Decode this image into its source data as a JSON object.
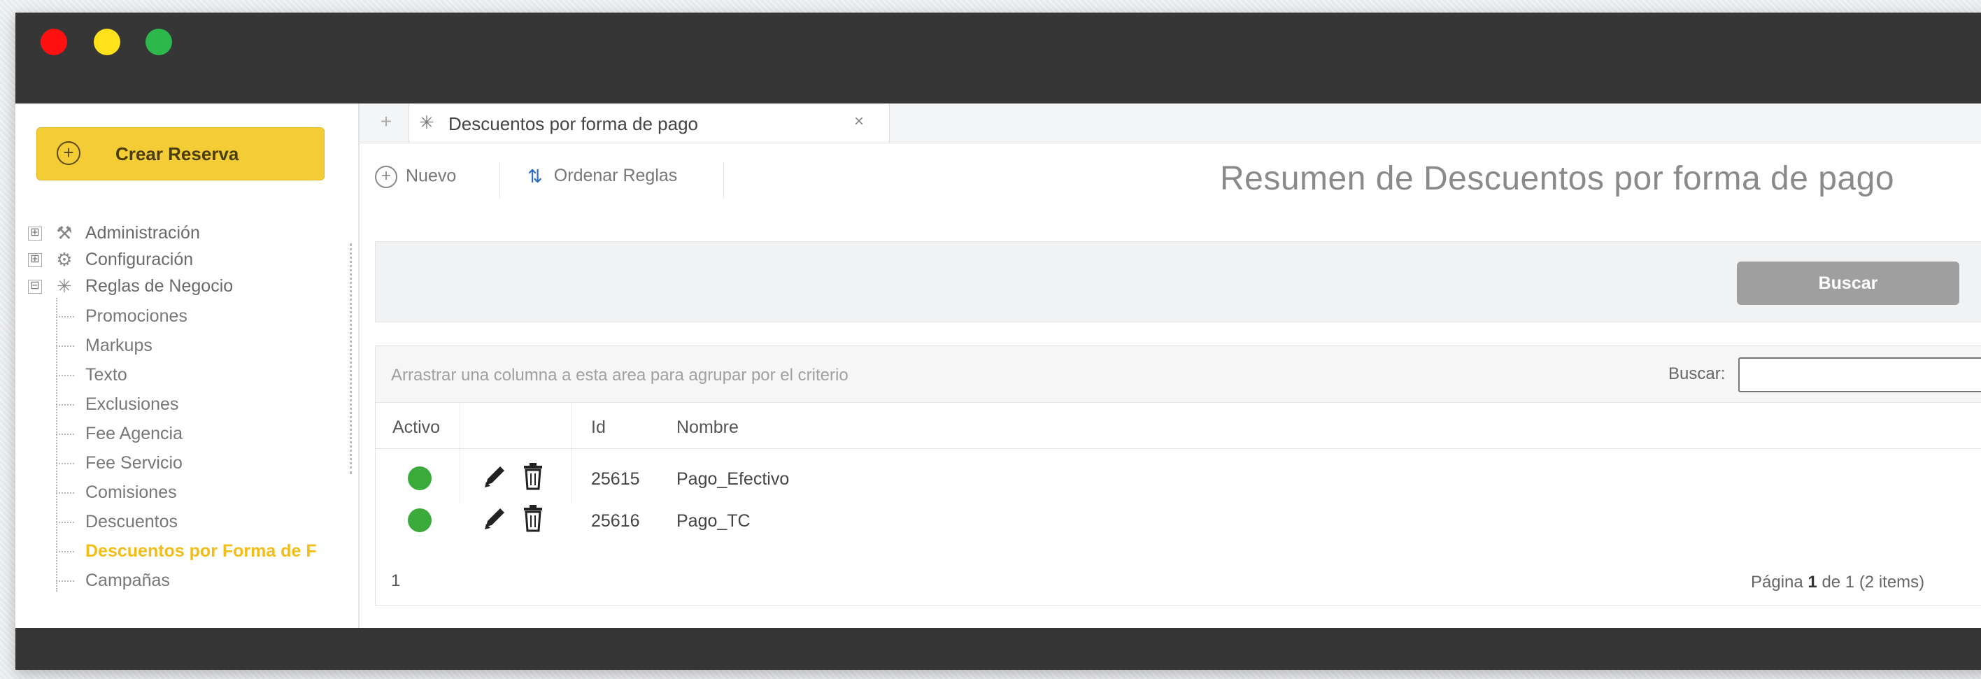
{
  "sidebar": {
    "create_label": "Crear Reserva",
    "tree": [
      {
        "label": "Administración",
        "icon": "tools-icon",
        "expander": "⊞"
      },
      {
        "label": "Configuración",
        "icon": "gear-icon",
        "expander": "⊞"
      },
      {
        "label": "Reglas de Negocio",
        "icon": "sparkle-icon",
        "expander": "⊟"
      }
    ],
    "items": [
      "Promociones",
      "Markups",
      "Texto",
      "Exclusiones",
      "Fee Agencia",
      "Fee Servicio",
      "Comisiones",
      "Descuentos",
      "Descuentos por Forma de F",
      "Campañas"
    ]
  },
  "tabs": {
    "add_symbol": "+",
    "active_label": "Descuentos por forma de pago",
    "close_symbol": "×"
  },
  "toolbar": {
    "new_label": "Nuevo",
    "sort_label": "Ordenar Reglas"
  },
  "page": {
    "title": "Resumen de Descuentos por forma de pago"
  },
  "filter": {
    "search_button": "Buscar"
  },
  "grid": {
    "group_hint": "Arrastrar una columna a esta area para agrupar por el criterio",
    "search_label": "Buscar:",
    "search_value": "",
    "columns": {
      "active": "Activo",
      "id": "Id",
      "name": "Nombre"
    },
    "rows": [
      {
        "id": "25615",
        "name": "Pago_Efectivo"
      },
      {
        "id": "25616",
        "name": "Pago_TC"
      }
    ],
    "page_number": "1",
    "pager": {
      "prefix": "Página",
      "current": "1",
      "suffix": "de 1 (2 items)"
    }
  },
  "colors": {
    "accent": "#f3cc36",
    "active_status": "#3aaa3a",
    "active_item": "#f2bd17"
  }
}
